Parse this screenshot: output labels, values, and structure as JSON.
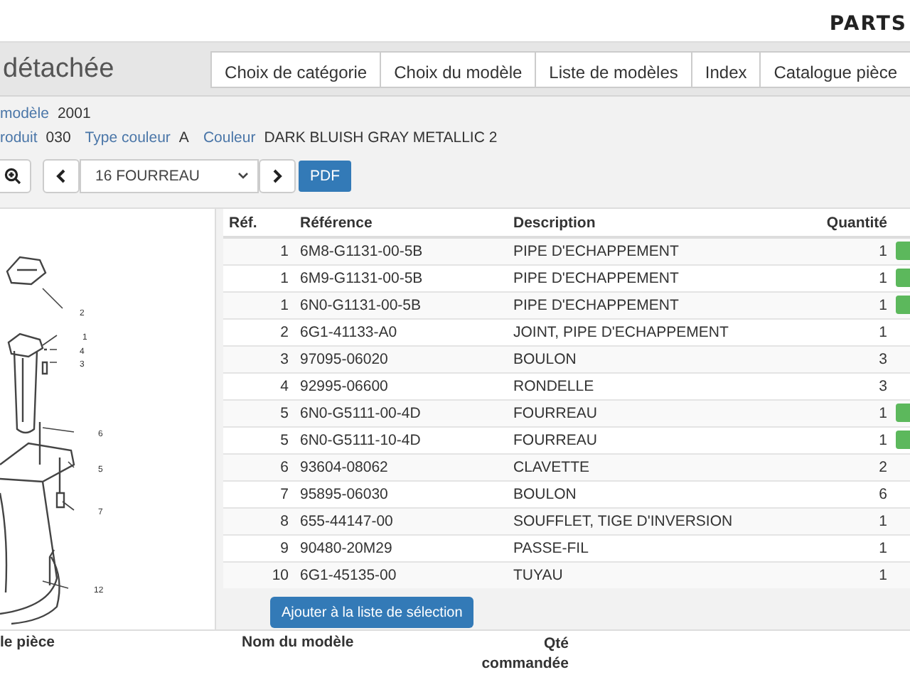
{
  "logo": "PARTS",
  "header": {
    "title": "détachée",
    "nav": [
      "Choix de catégorie",
      "Choix du modèle",
      "Liste de modèles",
      "Index",
      "Catalogue pièce"
    ]
  },
  "info": [
    [
      {
        "label": "modèle",
        "value": "2001"
      }
    ],
    [
      {
        "label": "roduit",
        "value": "030"
      },
      {
        "label": "Type couleur",
        "value": "A"
      },
      {
        "label": "Couleur",
        "value": "DARK BLUISH GRAY METALLIC 2"
      }
    ]
  ],
  "toolbar": {
    "selected_section": "16 FOURREAU",
    "pdf": "PDF"
  },
  "diagram": {
    "callouts": [
      "2",
      "1",
      "4",
      "3",
      "6",
      "5",
      "7",
      "12"
    ]
  },
  "table": {
    "columns": [
      "Réf.",
      "Référence",
      "Description",
      "Quantité"
    ],
    "rows": [
      {
        "ref": "1",
        "reference": "6M8-G1131-00-5B",
        "description": "PIPE D'ECHAPPEMENT",
        "quantity": "1",
        "available": true
      },
      {
        "ref": "1",
        "reference": "6M9-G1131-00-5B",
        "description": "PIPE D'ECHAPPEMENT",
        "quantity": "1",
        "available": true
      },
      {
        "ref": "1",
        "reference": "6N0-G1131-00-5B",
        "description": "PIPE D'ECHAPPEMENT",
        "quantity": "1",
        "available": true
      },
      {
        "ref": "2",
        "reference": "6G1-41133-A0",
        "description": "JOINT, PIPE D'ECHAPPEMENT",
        "quantity": "1",
        "available": false
      },
      {
        "ref": "3",
        "reference": "97095-06020",
        "description": "BOULON",
        "quantity": "3",
        "available": false
      },
      {
        "ref": "4",
        "reference": "92995-06600",
        "description": "RONDELLE",
        "quantity": "3",
        "available": false
      },
      {
        "ref": "5",
        "reference": "6N0-G5111-00-4D",
        "description": "FOURREAU",
        "quantity": "1",
        "available": true
      },
      {
        "ref": "5",
        "reference": "6N0-G5111-10-4D",
        "description": "FOURREAU",
        "quantity": "1",
        "available": true
      },
      {
        "ref": "6",
        "reference": "93604-08062",
        "description": "CLAVETTE",
        "quantity": "2",
        "available": false
      },
      {
        "ref": "7",
        "reference": "95895-06030",
        "description": "BOULON",
        "quantity": "6",
        "available": false
      },
      {
        "ref": "8",
        "reference": "655-44147-00",
        "description": "SOUFFLET, TIGE D'INVERSION",
        "quantity": "1",
        "available": false
      },
      {
        "ref": "9",
        "reference": "90480-20M29",
        "description": "PASSE-FIL",
        "quantity": "1",
        "available": false
      },
      {
        "ref": "10",
        "reference": "6G1-45135-00",
        "description": "TUYAU",
        "quantity": "1",
        "available": false
      }
    ],
    "add_button": "Ajouter à la liste de sélection"
  },
  "selection": {
    "columns": [
      "le pièce",
      "Nom du modèle",
      "Qté\ncommandée"
    ]
  }
}
